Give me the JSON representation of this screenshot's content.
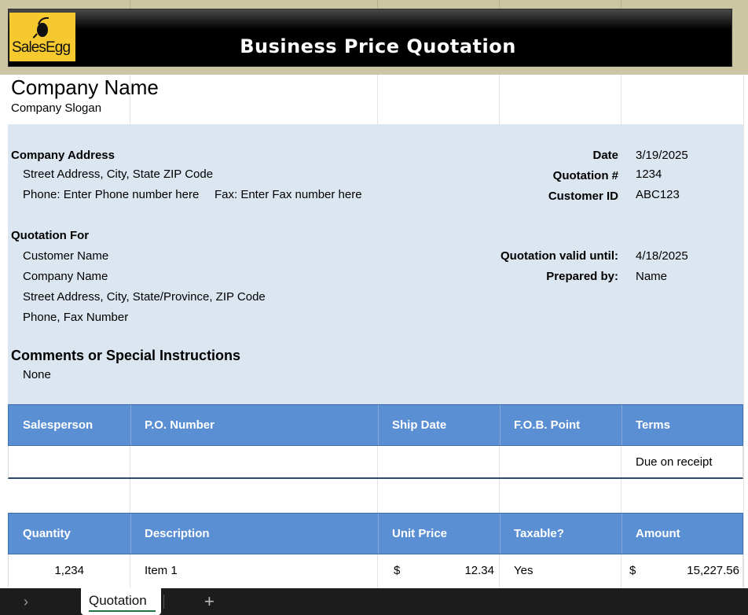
{
  "header": {
    "title": "Business Price Quotation",
    "logo_text": "SalesEgg"
  },
  "company": {
    "name": "Company Name",
    "slogan": "Company Slogan"
  },
  "address": {
    "heading": "Company Address",
    "street": "Street Address, City, State ZIP Code",
    "phone": "Phone: Enter Phone number here",
    "fax": "Fax: Enter Fax number here"
  },
  "meta": {
    "date_label": "Date",
    "date_value": "3/19/2025",
    "quote_label": "Quotation #",
    "quote_value": "1234",
    "customer_label": "Customer ID",
    "customer_value": "ABC123",
    "valid_label": "Quotation valid until:",
    "valid_value": "4/18/2025",
    "prepared_label": "Prepared by:",
    "prepared_value": "Name"
  },
  "quote_for": {
    "heading": "Quotation For",
    "lines": [
      "Customer Name",
      "Company Name",
      "Street Address, City, State/Province, ZIP Code",
      "Phone, Fax Number"
    ]
  },
  "comments": {
    "heading": "Comments or Special Instructions",
    "value": "None"
  },
  "shipping_table": {
    "headers": [
      "Salesperson",
      "P.O. Number",
      "Ship Date",
      "F.O.B. Point",
      "Terms"
    ],
    "row": [
      "",
      "",
      "",
      "",
      "Due on receipt"
    ]
  },
  "items_table": {
    "headers": [
      "Quantity",
      "Description",
      "Unit Price",
      "Taxable?",
      "Amount"
    ],
    "rows": [
      {
        "quantity": "1,234",
        "description": "Item 1",
        "currency": "$",
        "unit_price": "12.34",
        "taxable": "Yes",
        "amount_currency": "$",
        "amount": "15,227.56"
      }
    ]
  },
  "sheet_tabs": {
    "nav_icon": "chevron-right-icon",
    "active": "Quotation",
    "add_icon": "plus-icon"
  },
  "colors": {
    "banner": "#000000",
    "logo": "#f6c92e",
    "section_bg": "#dce6f0",
    "table_header": "#5a8fd3",
    "active_tab_accent": "#217346"
  }
}
